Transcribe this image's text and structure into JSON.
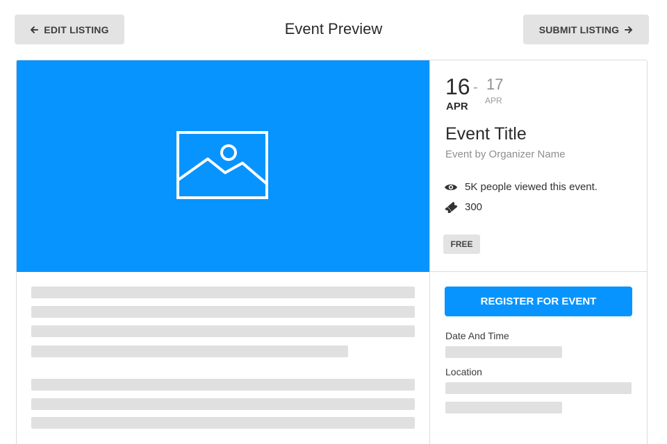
{
  "header": {
    "edit_label": "EDIT LISTING",
    "title": "Event Preview",
    "submit_label": "SUBMIT LISTING"
  },
  "event": {
    "start_day": "16",
    "start_month": "APR",
    "separator": "-",
    "end_day": "17",
    "end_month": "APR",
    "title": "Event Title",
    "organizer": "Event by Organizer Name",
    "views_text": "5K people viewed this event.",
    "tickets": "300",
    "price_badge": "FREE"
  },
  "sidebar": {
    "register_label": "REGISTER FOR EVENT",
    "date_label": "Date And Time",
    "location_label": "Location"
  },
  "colors": {
    "accent": "#0894ff",
    "button_gray": "#e3e3e3",
    "skeleton": "#e0e0e0"
  },
  "icons": [
    "arrow-left-icon",
    "arrow-right-icon",
    "image-placeholder-icon",
    "eye-icon",
    "ticket-icon"
  ]
}
